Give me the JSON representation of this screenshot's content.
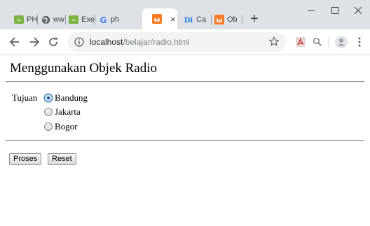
{
  "browser": {
    "tabs": [
      {
        "label": "PH",
        "favicon": "xampp-icon"
      },
      {
        "label": "ww",
        "favicon": "globe-icon"
      },
      {
        "label": "Exe",
        "favicon": "xampp-icon"
      },
      {
        "label": "ph",
        "favicon": "google-icon"
      },
      {
        "label": "",
        "favicon": "xampp-icon",
        "active": true
      },
      {
        "label": "Ca",
        "favicon": "di-icon"
      },
      {
        "label": "Ob",
        "favicon": "xampp-icon"
      }
    ],
    "tab_close_glyph": "×",
    "new_tab_glyph": "+",
    "url_host": "localhost",
    "url_path": "/belajar/radio.html",
    "accent": "#fb7a24"
  },
  "page": {
    "title": "Menggunakan Objek Radio",
    "field_label": "Tujuan",
    "options": [
      {
        "label": "Bandung",
        "checked": true
      },
      {
        "label": "Jakarta",
        "checked": false
      },
      {
        "label": "Bogor",
        "checked": false
      }
    ],
    "buttons": {
      "submit": "Proses",
      "reset": "Reset"
    }
  }
}
